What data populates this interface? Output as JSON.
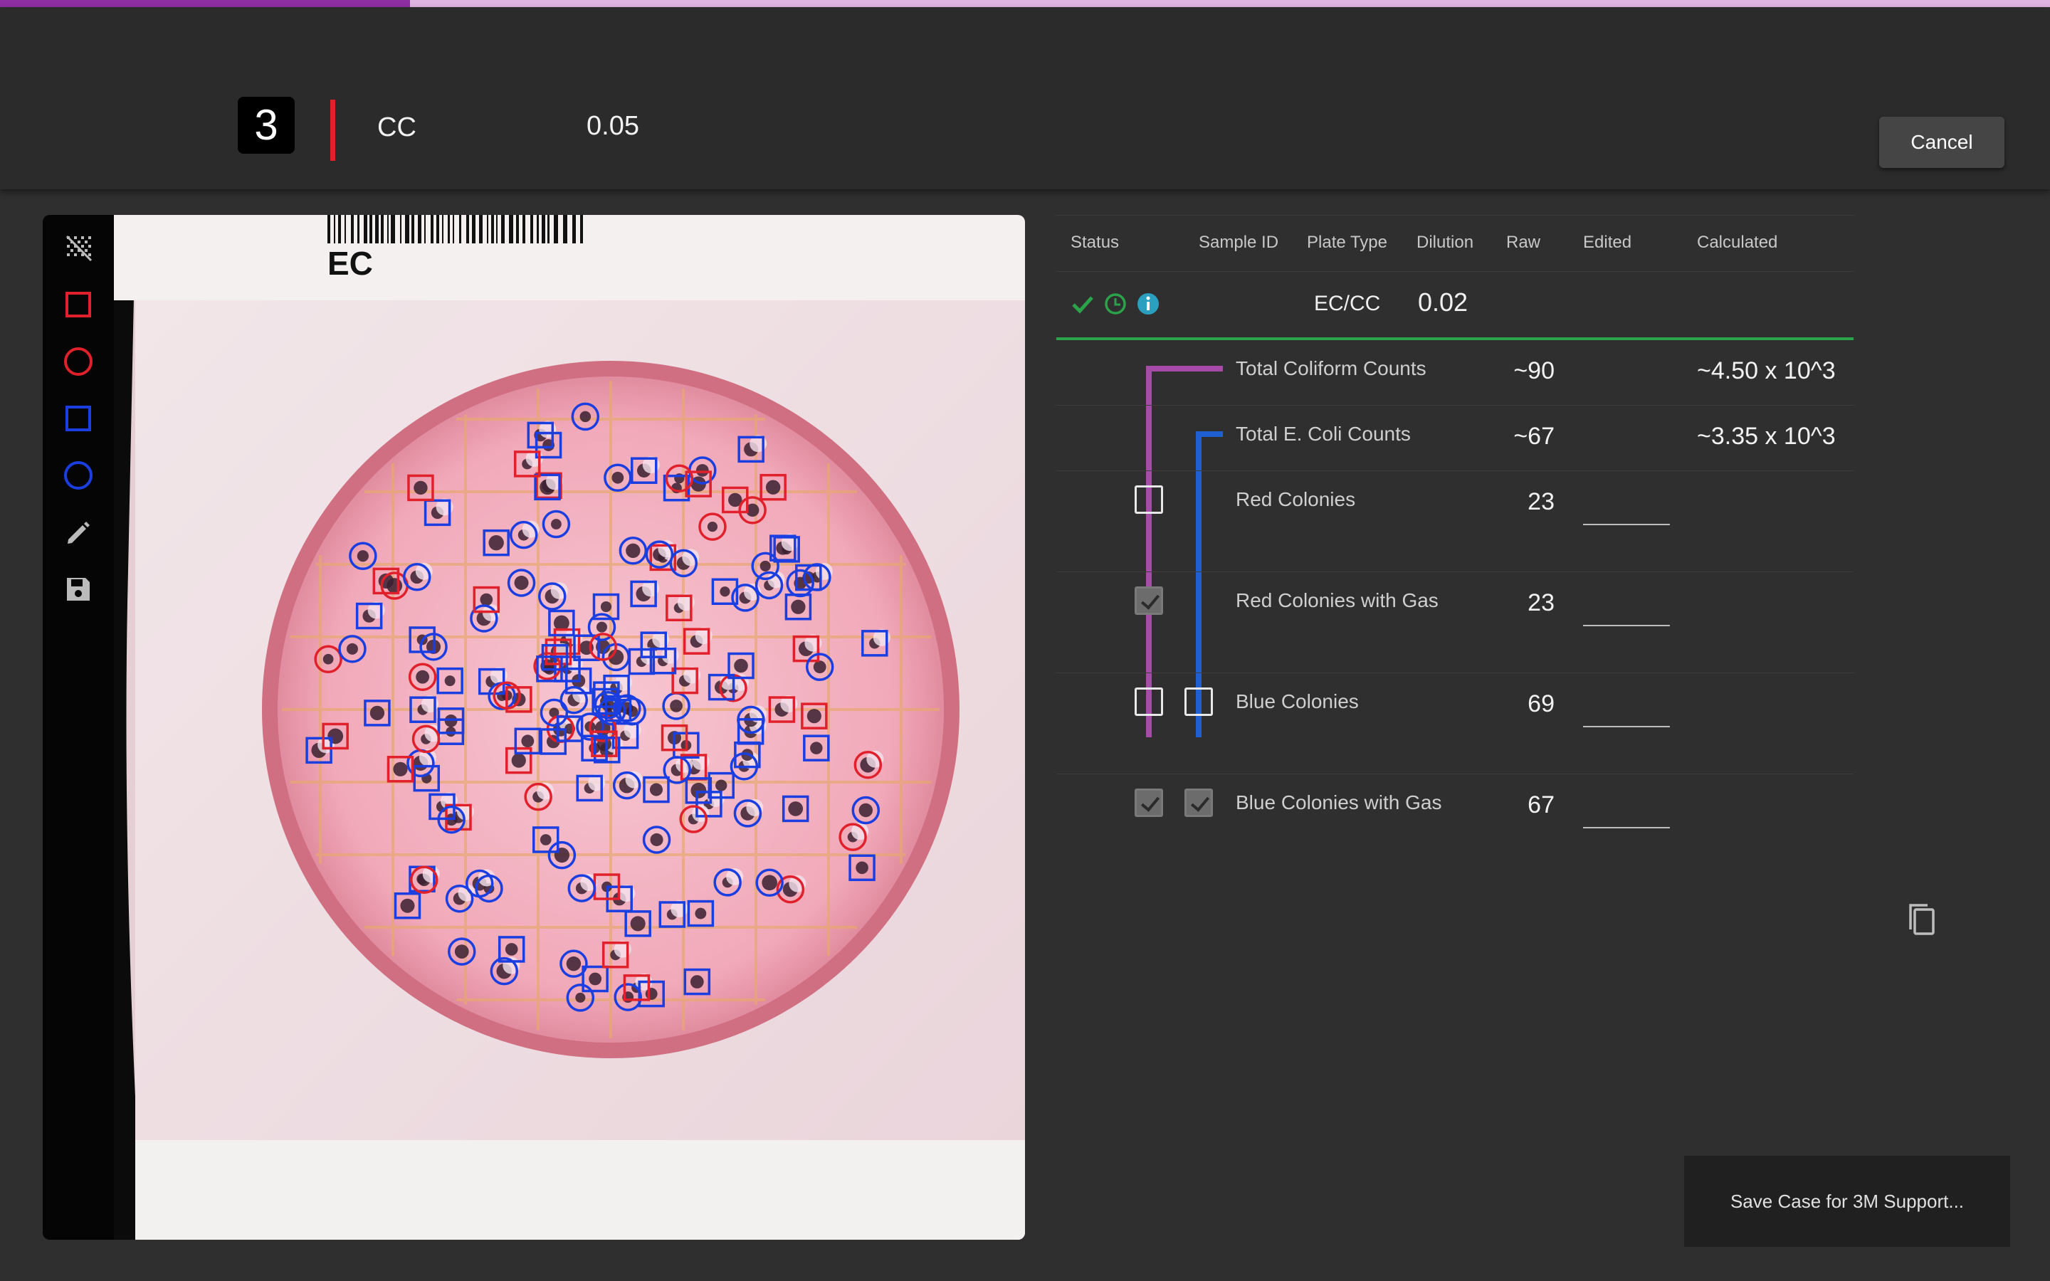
{
  "progress": {
    "fraction": 0.2
  },
  "header": {
    "plate_number": "3",
    "plate_type": "CC",
    "dilution": "0.05",
    "cancel_label": "Cancel"
  },
  "toolbar": {
    "tools": [
      "multi-select-icon",
      "red-square-icon",
      "red-circle-icon",
      "blue-square-icon",
      "blue-circle-icon",
      "pencil-icon",
      "save-icon"
    ]
  },
  "image": {
    "plate_label": "EC"
  },
  "table": {
    "headers": {
      "status": "Status",
      "sample_id": "Sample ID",
      "plate_type": "Plate Type",
      "dilution": "Dilution",
      "raw": "Raw",
      "edited": "Edited",
      "calculated": "Calculated"
    },
    "plate_row": {
      "status_icons": [
        "check-icon",
        "clock-icon",
        "info-icon"
      ],
      "sample_id": "",
      "plate_type": "EC/CC",
      "dilution": "0.02"
    },
    "rows": [
      {
        "label": "Total Coliform Counts",
        "raw": "~90",
        "calculated": "~4.50 x 10^3"
      },
      {
        "label": "Total E. Coli Counts",
        "raw": "~67",
        "calculated": "~3.35 x 10^3"
      },
      {
        "label": "Red Colonies",
        "raw": "23",
        "edited": ""
      },
      {
        "label": "Red Colonies with Gas",
        "raw": "23",
        "edited": ""
      },
      {
        "label": "Blue Colonies",
        "raw": "69",
        "edited": ""
      },
      {
        "label": "Blue Colonies with Gas",
        "raw": "67",
        "edited": ""
      }
    ]
  },
  "footer": {
    "save_case_label": "Save Case for 3M Support..."
  },
  "colors": {
    "accent_purple": "#8e2fa3",
    "divider_red": "#e0202a",
    "status_green": "#2aa34a",
    "coliform_tree": "#a64ca8",
    "ecoli_tree": "#1f5fd1",
    "marker_red": "#e0202a",
    "marker_blue": "#1a3ee0"
  }
}
